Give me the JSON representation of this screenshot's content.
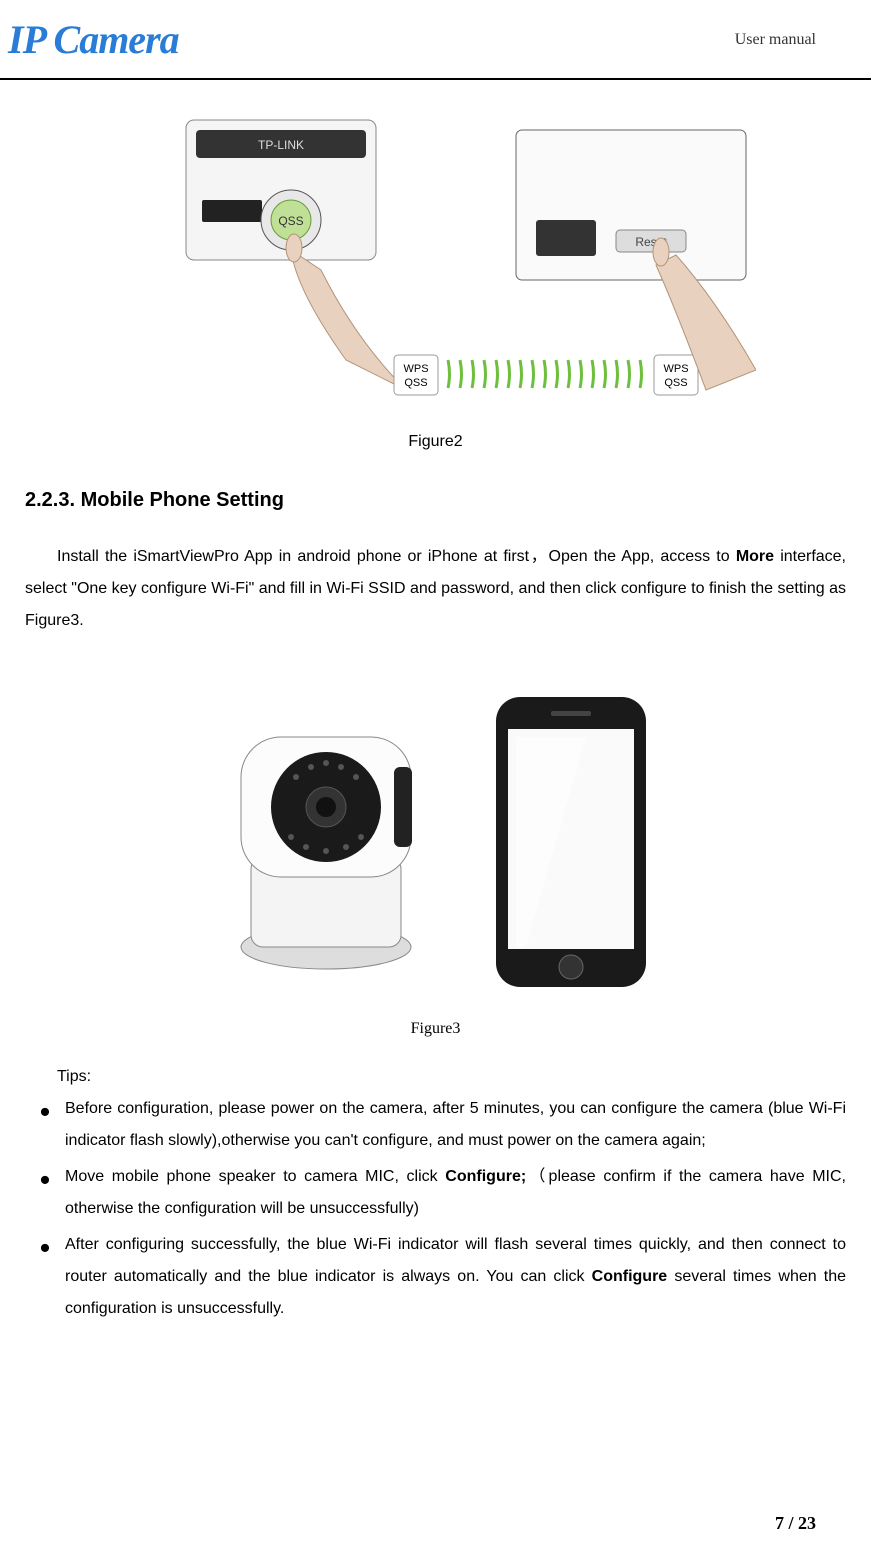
{
  "header": {
    "logo": "IP Camera",
    "label": "User manual"
  },
  "figure2": {
    "caption": "Figure2",
    "wps_label": "WPS\nQSS",
    "qss_btn": "QSS",
    "reset_btn": "Reset",
    "tplink": "TP-LINK"
  },
  "section": {
    "number": "2.2.3.",
    "title": "Mobile Phone Setting"
  },
  "para1": {
    "p1": "Install the iSmartViewPro App in android phone or iPhone at first，Open the App, access to ",
    "b1": "More",
    "p2": " interface, select \"One key configure Wi-Fi\" and fill in Wi-Fi SSID and password, and then click configure to finish the setting as Figure3."
  },
  "figure3": {
    "caption": "Figure3"
  },
  "tips_label": "Tips:",
  "bullets": [
    {
      "t1": "Before configuration, please power on the camera, after 5 minutes, you can configure the camera (blue Wi-Fi indicator flash slowly),otherwise you can't configure, and must power on the camera again;"
    },
    {
      "t1": "Move mobile phone speaker to camera MIC, click ",
      "b1": "Configure;",
      "t2": "（please confirm if the camera have MIC, otherwise the configuration will be unsuccessfully)"
    },
    {
      "t1": "After configuring successfully, the blue Wi-Fi indicator will flash several times quickly, and then connect to router automatically and the blue indicator is always on. You can click ",
      "b1": "Configure",
      "t2": " several times when the configuration is unsuccessfully."
    }
  ],
  "footer": {
    "page": "7 / 23"
  }
}
